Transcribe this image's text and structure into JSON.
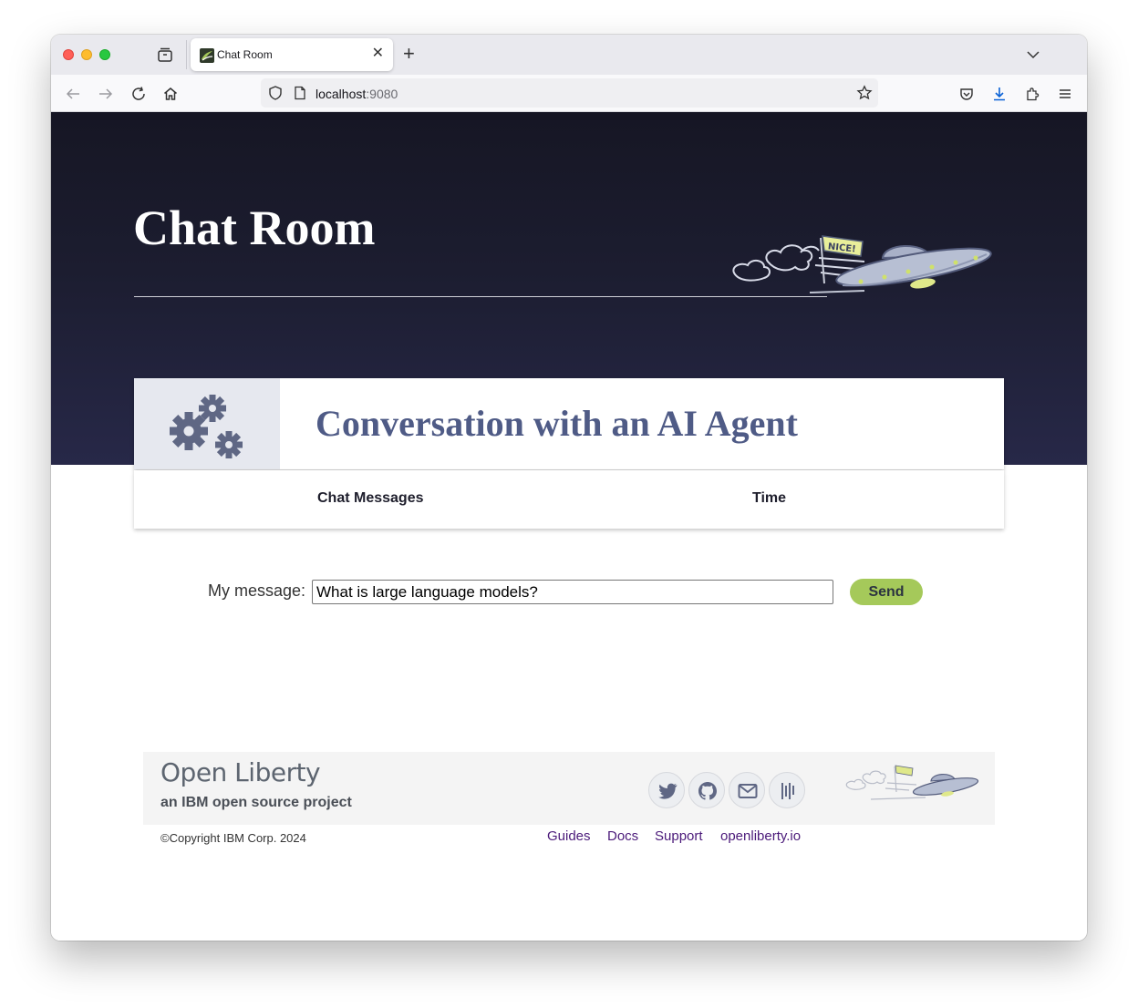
{
  "browser": {
    "tab_title": "Chat Room",
    "tab_close": "✕",
    "new_tab": "+",
    "url_host": "localhost",
    "url_port": ":9080"
  },
  "hero": {
    "title": "Chat Room"
  },
  "card": {
    "title": "Conversation with an AI Agent",
    "columns": [
      "Chat Messages",
      "Time"
    ]
  },
  "composer": {
    "label": "My message:",
    "value": "What is large language models?",
    "send_label": "Send"
  },
  "footer": {
    "logo": "Open Liberty",
    "tagline": "an IBM open source project",
    "social": [
      "twitter-icon",
      "github-icon",
      "mail-icon",
      "groups-icon"
    ],
    "copyright": "©Copyright IBM Corp. 2024",
    "links": [
      "Guides",
      "Docs",
      "Support",
      "openliberty.io"
    ]
  },
  "illustration": {
    "flag_text": "NICE!"
  },
  "colors": {
    "hero_bg": "#1c1d30",
    "card_title": "#4f5b86",
    "send_button": "#a5c95a",
    "footer_link": "#4b1a7a"
  }
}
